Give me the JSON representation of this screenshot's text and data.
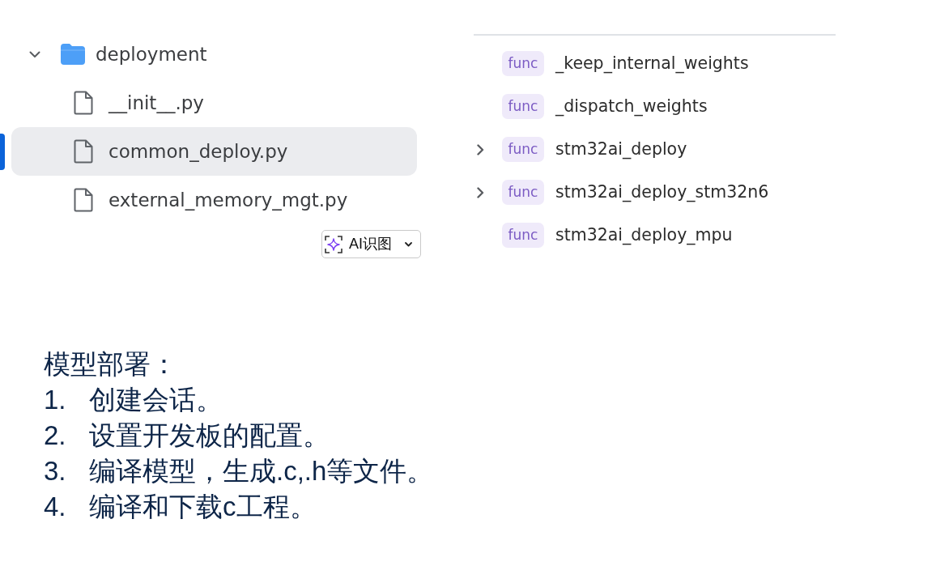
{
  "file_tree": {
    "items": [
      {
        "kind": "folder",
        "label": "deployment",
        "expanded": true,
        "selected": false,
        "children": [
          {
            "kind": "file",
            "label": "__init__.py",
            "selected": false
          },
          {
            "kind": "file",
            "label": "common_deploy.py",
            "selected": true
          },
          {
            "kind": "file",
            "label": "external_memory_mgt.py",
            "selected": false
          }
        ]
      }
    ]
  },
  "ai_button": {
    "label": "AI识图"
  },
  "outline": {
    "items": [
      {
        "badge": "func",
        "name": "_keep_internal_weights",
        "expandable": false
      },
      {
        "badge": "func",
        "name": "_dispatch_weights",
        "expandable": false
      },
      {
        "badge": "func",
        "name": "stm32ai_deploy",
        "expandable": true
      },
      {
        "badge": "func",
        "name": "stm32ai_deploy_stm32n6",
        "expandable": true
      },
      {
        "badge": "func",
        "name": "stm32ai_deploy_mpu",
        "expandable": false
      }
    ]
  },
  "notes": {
    "heading": "模型部署：",
    "steps": [
      {
        "number": "1.",
        "text": "创建会话。"
      },
      {
        "number": "2.",
        "text": "设置开发板的配置。"
      },
      {
        "number": "3.",
        "text": "编译模型，生成.c,.h等文件。"
      },
      {
        "number": "4.",
        "text": "编译和下载c工程。"
      }
    ]
  }
}
